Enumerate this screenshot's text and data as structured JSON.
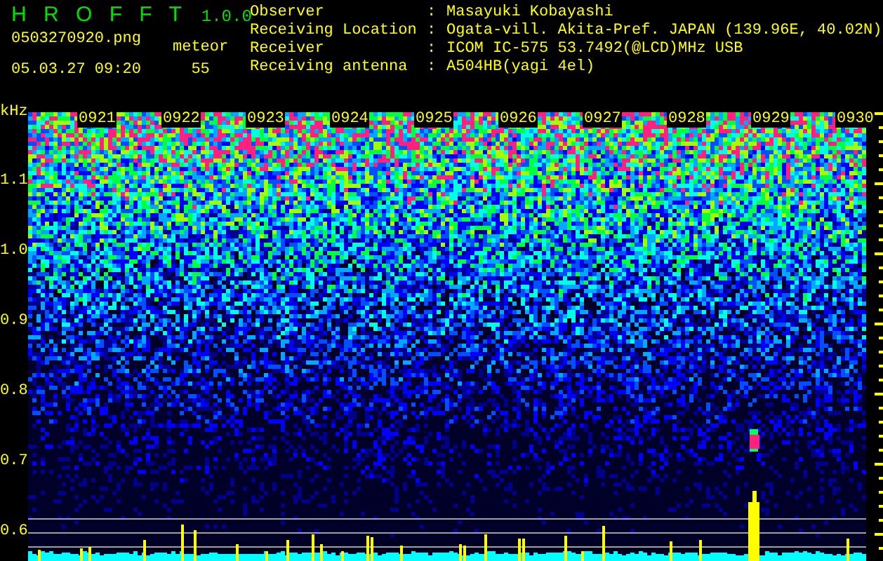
{
  "app": {
    "title": "H R O F F T",
    "version": "1.0.0"
  },
  "file": {
    "name": "0503270920.png",
    "datetime": "05.03.27 09:20"
  },
  "meteor": {
    "label": "meteor",
    "count": "55"
  },
  "info": [
    {
      "label": "Observer",
      "separator": ":",
      "value": "Masayuki Kobayashi"
    },
    {
      "label": "Receiving Location",
      "separator": ":",
      "value": "Ogata-vill. Akita-Pref. JAPAN (139.96E, 40.02N)"
    },
    {
      "label": "Receiver",
      "separator": ":",
      "value": "ICOM IC-575 53.7492(@LCD)MHz USB"
    },
    {
      "label": "Receiving antenna",
      "separator": ":",
      "value": "A504HB(yagi 4el)"
    }
  ],
  "spectrogram": {
    "unit": "kHz",
    "y_ticks": [
      "1.1",
      "1.0",
      "0.9",
      "0.8",
      "0.7",
      "0.6"
    ],
    "time_labels": [
      "0921",
      "0922",
      "0923",
      "0924",
      "0925",
      "0926",
      "0927",
      "0928",
      "0929",
      "0930"
    ]
  }
}
